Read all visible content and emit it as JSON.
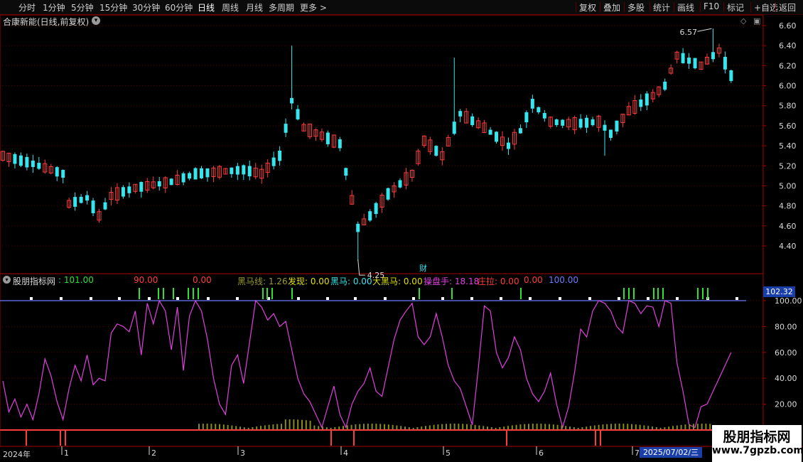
{
  "toolbar": {
    "left": [
      "分时",
      "1分钟",
      "5分钟",
      "15分钟",
      "30分钟",
      "60分钟",
      "日线",
      "周线",
      "月线",
      "多周期",
      "更多"
    ],
    "more_arrow": ">",
    "right": [
      "复权",
      "叠加",
      "多股",
      "统计",
      "画线",
      "F10",
      "标记",
      "+自选",
      "返回"
    ],
    "active": "日线"
  },
  "caption": "合康新能(日线,前复权)",
  "top_icons": [
    "◇",
    "▣"
  ],
  "price_axis": [
    "6.60",
    "6.40",
    "6.20",
    "6.00",
    "5.80",
    "5.60",
    "5.40",
    "5.20",
    "5.00",
    "4.80",
    "4.60",
    "4.40"
  ],
  "annotations": {
    "high": "6.57",
    "low": "4.25",
    "cai": "财"
  },
  "indicator": {
    "name": "股朋指标网",
    "v1": ": 101.00",
    "v2": "90.00",
    "v3": "0.00",
    "heima_line": "黑马线: 1.26",
    "faxian": "发现: 0.00",
    "heima": "黑马: 0.00",
    "da_heima": "大黑马: 0.00",
    "caopanshou": "操盘手: 18.18",
    "zhuangla": "庄拉: 0.00",
    "v4": "0.00",
    "v5": "100.00"
  },
  "ind_axis": [
    "100.00",
    "80.00",
    "60.00",
    "40.00",
    "20.00"
  ],
  "price_tag": "102.32",
  "dates": {
    "year": "2024年",
    "months": [
      "1",
      "2",
      "3",
      "4",
      "5",
      "6",
      "7"
    ],
    "current": "2025/07/02/三"
  },
  "watermark": {
    "line1": "股朋指标网",
    "line2": "www.7gpzb.com"
  },
  "colors": {
    "up": "#ff3c3c",
    "down": "#36e6ee",
    "ind_line": "#e040e0",
    "green": "#30e030",
    "yellow": "#e0e000",
    "axis_red": "#a80000"
  }
}
